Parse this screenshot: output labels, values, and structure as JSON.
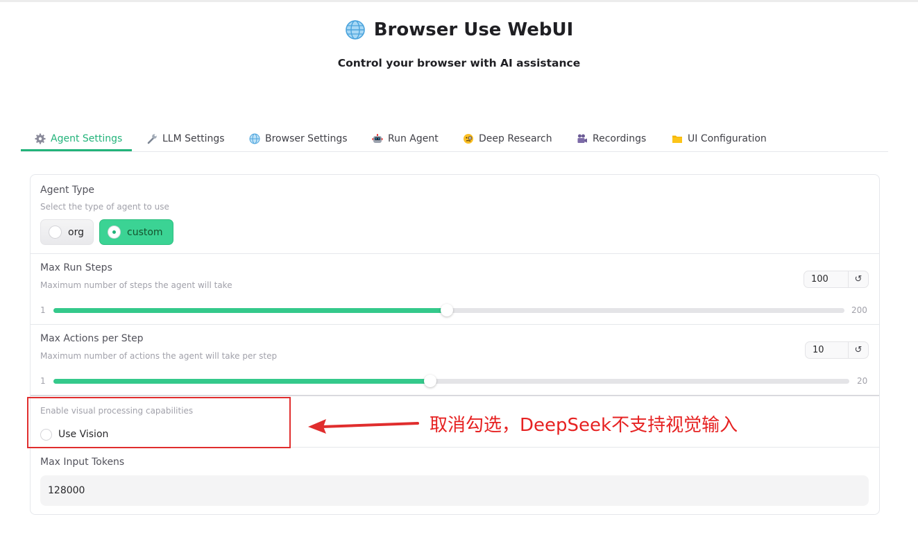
{
  "app": {
    "title": "Browser Use WebUI",
    "subtitle": "Control your browser with AI assistance",
    "title_icon": "globe-icon"
  },
  "tabs": [
    {
      "label": "Agent Settings",
      "icon": "gear-icon",
      "active": true
    },
    {
      "label": "LLM Settings",
      "icon": "wrench-icon",
      "active": false
    },
    {
      "label": "Browser Settings",
      "icon": "globe-icon",
      "active": false
    },
    {
      "label": "Run Agent",
      "icon": "robot-icon",
      "active": false
    },
    {
      "label": "Deep Research",
      "icon": "monocle-face-icon",
      "active": false
    },
    {
      "label": "Recordings",
      "icon": "movie-camera-icon",
      "active": false
    },
    {
      "label": "UI Configuration",
      "icon": "folder-icon",
      "active": false
    }
  ],
  "agent_type": {
    "label": "Agent Type",
    "info": "Select the type of agent to use",
    "options": [
      "org",
      "custom"
    ],
    "selected": "custom"
  },
  "max_run_steps": {
    "label": "Max Run Steps",
    "info": "Maximum number of steps the agent will take",
    "value": "100",
    "min": "1",
    "max": "200",
    "reset_icon": "↺"
  },
  "max_actions": {
    "label": "Max Actions per Step",
    "info": "Maximum number of actions the agent will take per step",
    "value": "10",
    "min": "1",
    "max": "20",
    "reset_icon": "↺"
  },
  "use_vision": {
    "info": "Enable visual processing capabilities",
    "label": "Use Vision",
    "checked": false
  },
  "max_input_tokens": {
    "label": "Max Input Tokens",
    "value": "128000"
  },
  "annotation": {
    "text": "取消勾选，DeepSeek不支持视觉输入",
    "color": "#e62222"
  },
  "colors": {
    "accent": "#22b37a",
    "selected_radio": "#3bd394",
    "slider_fill": "#34c98b",
    "annotation_red": "#e02d2d"
  }
}
